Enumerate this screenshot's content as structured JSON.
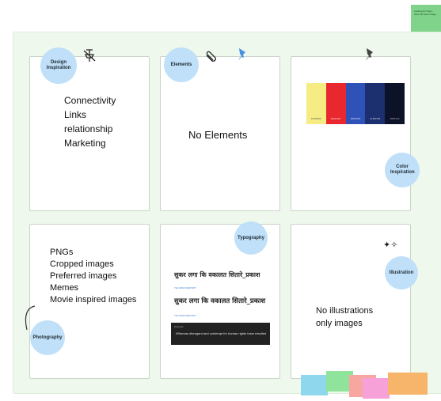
{
  "corner_sticky": {
    "text": "Looking for inspir… Give Ink Feed: Page…",
    "color": "#7fd38a"
  },
  "cards": {
    "design": {
      "badge": "Design Inspiration",
      "lines": [
        "Connectivity",
        "Links",
        "relationship",
        "Marketing"
      ]
    },
    "elements": {
      "badge": "Elements",
      "text": "No Elements"
    },
    "color": {
      "badge": "Color Inspiration",
      "swatch_colors": [
        "#f5ec84",
        "#e8282e",
        "#2e52b8",
        "#1c2f6e",
        "#0c1228"
      ],
      "swatch_labels": [
        "#F7EF8A",
        "#E11D2C",
        "#2B4FB3",
        "#1B2C6B",
        "#0B1126"
      ]
    },
    "photography": {
      "badge": "Photography",
      "lines": [
        "PNGs",
        "Cropped images",
        "Preferred images",
        "Memes",
        "Movie inspired images"
      ]
    },
    "typography": {
      "badge": "Typography",
      "hindi_1": "सुकर लगा कि वकालत सितारे_प्रकाश",
      "label_1": "TEJ HINDI REPORT",
      "hindi_2": "सुकर लगा कि वकालत सितारे_प्रकाश",
      "label_2": "TEJ HINDI REPORT",
      "dark_label": "Example",
      "dark_text": "Whereas disregard and contempt for human rights have resulted"
    },
    "illustration": {
      "badge": "Illustration",
      "lines": [
        "No illustrations",
        "only images"
      ]
    }
  },
  "sticky_notes": [
    "#8fd7ec",
    "#8fe39a",
    "#f7a7a0",
    "#f7a1d9",
    "#f6b56a"
  ]
}
